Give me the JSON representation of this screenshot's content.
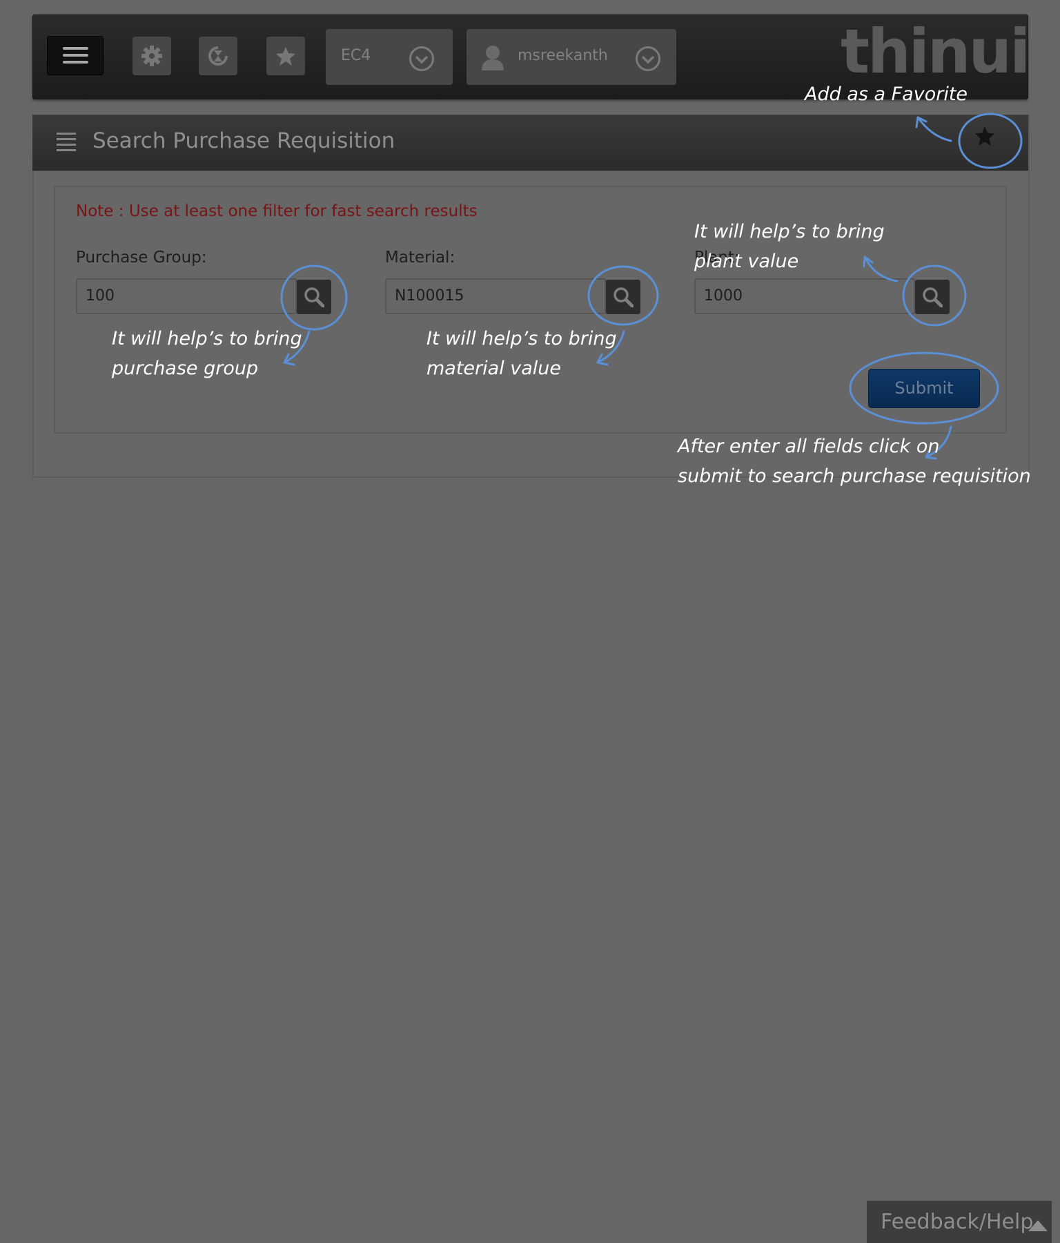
{
  "topbar": {
    "menu_icon": "hamburger-icon",
    "settings_icon": "gear-icon",
    "history_icon": "history-icon",
    "favorites_icon": "star-icon",
    "system_select": "EC4",
    "user_select": "msreekanth",
    "logo": "thinui"
  },
  "panel": {
    "title": "Search Purchase Requisition",
    "favorite_icon": "star-icon",
    "note": "Note : Use at least one filter for fast search results",
    "fields": [
      {
        "label": "Purchase Group:",
        "value": "100"
      },
      {
        "label": "Material:",
        "value": "N100015"
      },
      {
        "label": "Plant:",
        "value": "1000"
      }
    ],
    "submit_label": "Submit"
  },
  "annotations": {
    "favorite_line1": "Add as a Favorite",
    "plant_line1": "It will help’s to bring",
    "plant_line2": "plant value",
    "pg_line1": "It will help’s to bring",
    "pg_line2": "purchase group",
    "mat_line1": "It will help’s to bring",
    "mat_line2": "material value",
    "submit_line1": "After enter all fields click on",
    "submit_line2": "submit to search purchase requisition",
    "color": "#5b8fd6"
  },
  "feedback": {
    "label": "Feedback/Help"
  }
}
